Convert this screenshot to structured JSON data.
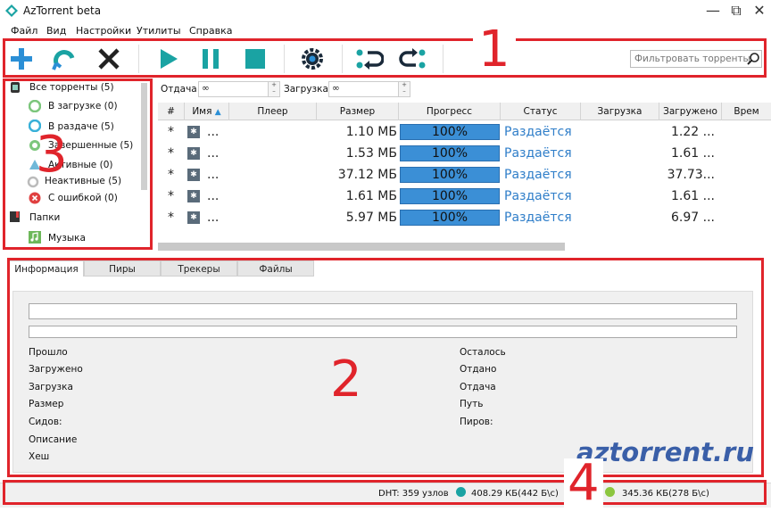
{
  "window": {
    "title": "AzTorrent beta",
    "minimize": "—",
    "restore": "⧉",
    "close": "✕"
  },
  "menu": [
    "Файл",
    "Вид",
    "Настройки",
    "Утилиты",
    "Справка"
  ],
  "toolbar": {
    "filter_placeholder": "Фильтровать торренты"
  },
  "tree": {
    "all": "Все торренты (5)",
    "downloading": "В загрузке (0)",
    "seeding": "В раздаче (5)",
    "completed": "Завершенные (5)",
    "active": "Активные (0)",
    "inactive": "Неактивные (5)",
    "error": "С ошибкой (0)",
    "folders": "Папки",
    "music": "Музыка"
  },
  "speed": {
    "upload_label": "Отдача",
    "upload_value": "∞",
    "download_label": "Загрузка",
    "download_value": "∞"
  },
  "table": {
    "headers": [
      "#",
      "Имя",
      "Плеер",
      "Размер",
      "Прогресс",
      "Статус",
      "Загрузка",
      "Загружено",
      "Врем"
    ],
    "rows": [
      {
        "num": "*",
        "name": "...",
        "size": "1.10 МБ",
        "progress": "100%",
        "progress_value": 1.0,
        "status": "Раздаётся",
        "downloaded": "1.22 ..."
      },
      {
        "num": "*",
        "name": "...",
        "size": "1.53 МБ",
        "progress": "100%",
        "progress_value": 1.0,
        "status": "Раздаётся",
        "downloaded": "1.61 ..."
      },
      {
        "num": "*",
        "name": "...",
        "size": "37.12 МБ",
        "progress": "100%",
        "progress_value": 1.0,
        "status": "Раздаётся",
        "downloaded": "37.73..."
      },
      {
        "num": "*",
        "name": "...",
        "size": "1.61 МБ",
        "progress": "100%",
        "progress_value": 1.0,
        "status": "Раздаётся",
        "downloaded": "1.61 ..."
      },
      {
        "num": "*",
        "name": "...",
        "size": "5.97 МБ",
        "progress": "100%",
        "progress_value": 1.0,
        "status": "Раздаётся",
        "downloaded": "6.97 ..."
      }
    ]
  },
  "tabs": [
    "Информация",
    "Пиры",
    "Трекеры",
    "Файлы"
  ],
  "info": {
    "left": [
      "Прошло",
      "Загружено",
      "Загрузка",
      "Размер",
      "Сидов:",
      "Описание",
      "Хеш"
    ],
    "right": [
      "Осталось",
      "Отдано",
      "Отдача",
      "Путь",
      "Пиров:"
    ]
  },
  "watermark": "aztorrent.ru",
  "status": {
    "dht": "DHT: 359 узлов",
    "down_speed": "408.29 КБ(442 Б\\с)",
    "up_speed": "345.36 КБ(278 Б\\с)"
  },
  "annotations": [
    "1",
    "2",
    "3",
    "4"
  ],
  "colors": {
    "accent_blue": "#2b8fd6",
    "teal": "#1aa3a3",
    "annotation_red": "#e0242b",
    "progress_fill": "#3b8fd6",
    "status_text": "#2f7ec9"
  }
}
